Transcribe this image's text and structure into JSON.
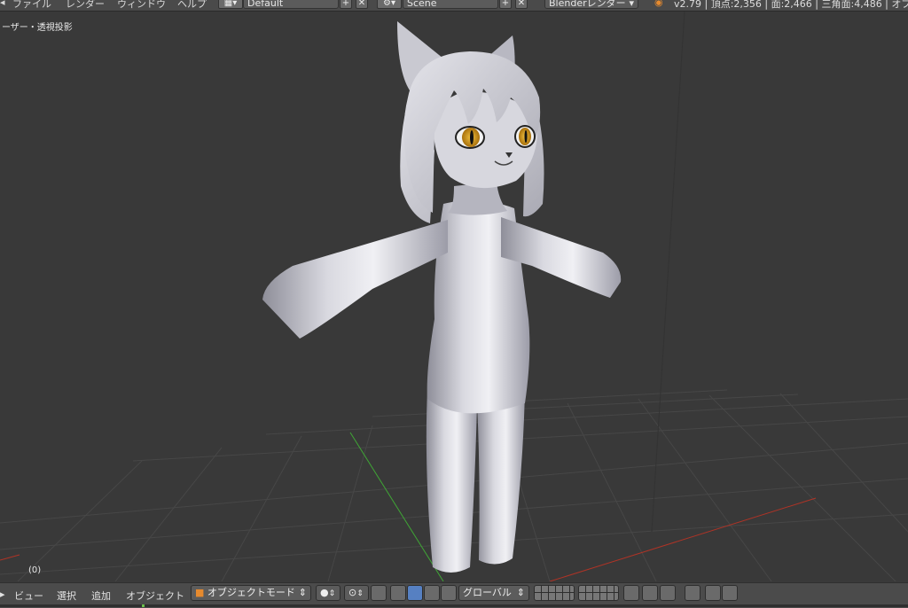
{
  "menu": [
    "ファイル",
    "レンダー",
    "ウィンドウ",
    "ヘルプ"
  ],
  "screen_layout": "Default",
  "scene": "Scene",
  "render_engine": "Blenderレンダー",
  "stats": "v2.79 | 頂点:2,356 | 面:2,466 | 三角面:4,486 | オブジェク",
  "viewport": {
    "label": "ーザー・透視投影",
    "frame": "(0)"
  },
  "bottom_menu": [
    "ビュー",
    "選択",
    "追加",
    "オブジェクト"
  ],
  "mode": "オブジェクトモード",
  "transform_orientation": "グローバル",
  "icons": {
    "add": "+",
    "remove": "✕",
    "dropdown": "▾"
  },
  "colors": {
    "background": "#393939",
    "grid": "#474747",
    "x_axis": "#c0392b",
    "y_axis": "#3fa535",
    "model": "#c8c8d0",
    "eye": "#c98a12"
  }
}
